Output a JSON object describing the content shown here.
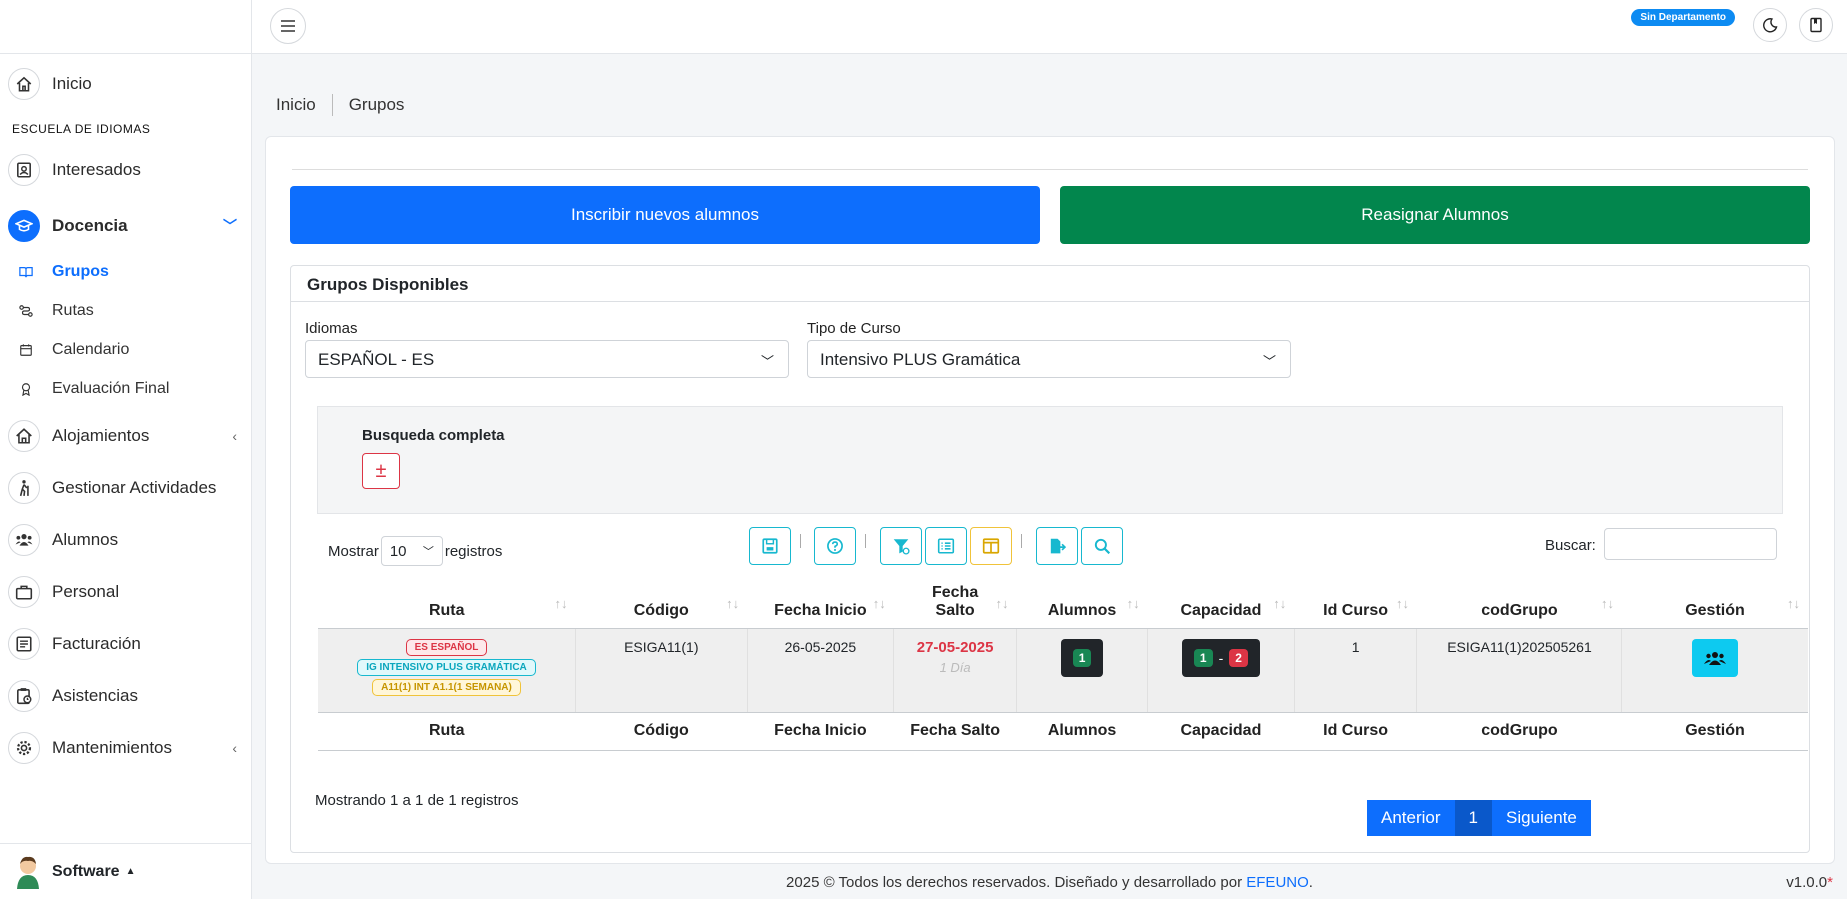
{
  "sidebar": {
    "home": "Inicio",
    "section": "ESCUELA DE IDIOMAS",
    "items": {
      "interesados": "Interesados",
      "docencia": "Docencia",
      "alojamientos": "Alojamientos",
      "actividades": "Gestionar Actividades",
      "alumnos": "Alumnos",
      "personal": "Personal",
      "facturacion": "Facturación",
      "asistencias": "Asistencias",
      "mantenimientos": "Mantenimientos"
    },
    "sub": {
      "grupos": "Grupos",
      "rutas": "Rutas",
      "calendario": "Calendario",
      "evaluacion": "Evaluación Final"
    },
    "user": "Software"
  },
  "topbar": {
    "department_badge": "Sin Departamento"
  },
  "breadcrumb": {
    "home": "Inicio",
    "current": "Grupos"
  },
  "actions": {
    "inscribir": "Inscribir nuevos alumnos",
    "reasignar": "Reasignar Alumnos"
  },
  "panel": {
    "title": "Grupos Disponibles",
    "idiomas_label": "Idiomas",
    "idiomas_value": "ESPAÑOL - ES",
    "tipo_label": "Tipo de Curso",
    "tipo_value": "Intensivo PLUS Gramática",
    "busqueda": "Busqueda completa",
    "plusminus": "±",
    "mostrar": "Mostrar",
    "page_len": "10",
    "registros": "registros",
    "buscar": "Buscar:"
  },
  "table": {
    "headers": {
      "ruta": "Ruta",
      "codigo": "Código",
      "fecha_inicio": "Fecha Inicio",
      "fecha_salto_1": "Fecha",
      "fecha_salto_2": "Salto",
      "fecha_salto": "Fecha Salto",
      "alumnos": "Alumnos",
      "capacidad": "Capacidad",
      "id_curso": "Id Curso",
      "cod_grupo": "codGrupo",
      "gestion": "Gestión"
    },
    "row": {
      "tag1": "ES ESPAÑOL",
      "tag2": "IG INTENSIVO PLUS GRAMÁTICA",
      "tag3": "A11(1) INT A1.1(1 SEMANA)",
      "codigo": "ESIGA11(1)",
      "fecha_inicio": "26-05-2025",
      "fecha_salto": "27-05-2025",
      "dia": "1 Día",
      "alumnos": "1",
      "cap_min": "1",
      "cap_dash": "-",
      "cap_max": "2",
      "id_curso": "1",
      "cod_grupo": "ESIGA11(1)202505261"
    }
  },
  "info": "Mostrando 1 a 1 de 1 registros",
  "pager": {
    "prev": "Anterior",
    "page": "1",
    "next": "Siguiente"
  },
  "footer": {
    "text": "2025 © Todos los derechos reservados. Diseñado y desarrollado por ",
    "link": "EFEUNO",
    "dot": "."
  },
  "version": {
    "number": "v1.0.0",
    "mark": "*"
  }
}
